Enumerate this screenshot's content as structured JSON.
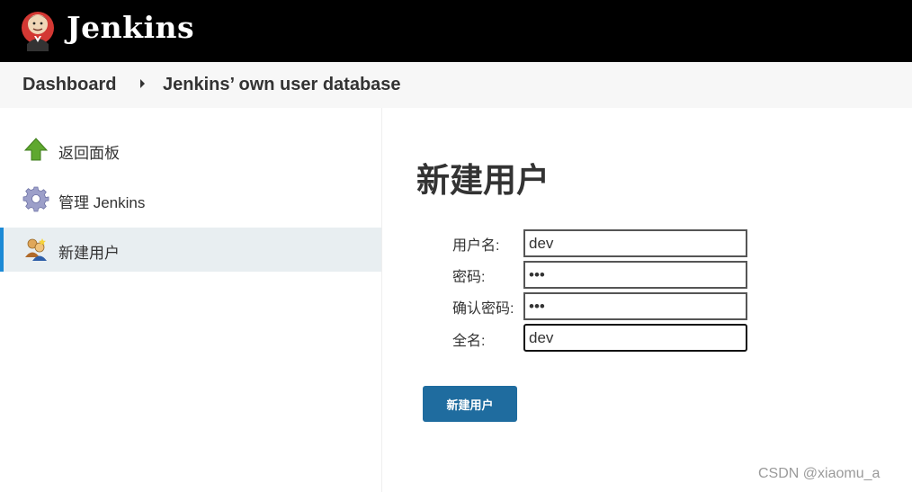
{
  "header": {
    "brand": "Jenkins"
  },
  "breadcrumb": {
    "items": [
      "Dashboard",
      "Jenkins’ own user database"
    ]
  },
  "sidebar": {
    "items": [
      {
        "label": "返回面板",
        "icon": "up-arrow-icon"
      },
      {
        "label": "管理 Jenkins",
        "icon": "gear-icon"
      },
      {
        "label": "新建用户",
        "icon": "users-icon",
        "active": true
      }
    ]
  },
  "main": {
    "title": "新建用户",
    "form": {
      "fields": [
        {
          "label": "用户名:",
          "value": "dev",
          "type": "text"
        },
        {
          "label": "密码:",
          "value": "•••",
          "type": "password"
        },
        {
          "label": "确认密码:",
          "value": "•••",
          "type": "password"
        },
        {
          "label": "全名:",
          "value": "dev",
          "type": "text"
        }
      ],
      "submit_label": "新建用户"
    }
  },
  "watermark": "CSDN @xiaomu_a",
  "colors": {
    "header_bg": "#000000",
    "breadcrumb_bg": "#f7f7f7",
    "active_item_bg": "#e8eef1",
    "active_item_border": "#1c8ad6",
    "button_bg": "#1f6c9f"
  }
}
